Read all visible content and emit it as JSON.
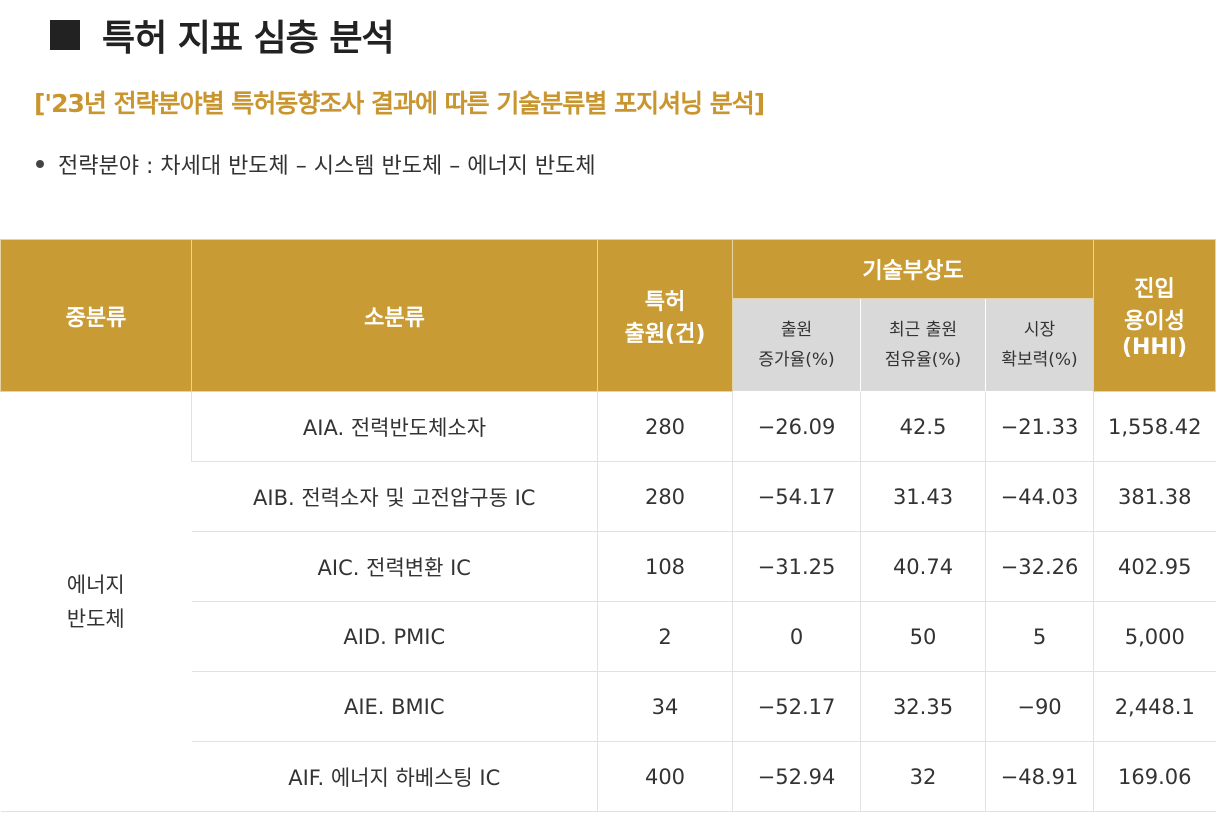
{
  "page": {
    "title": "특허 지표 심층 분석",
    "subtitle": "['23년 전략분야별 특허동향조사 결과에 따른 기술분류별 포지셔닝 분석]",
    "bullet": "전략분야 : 차세대 반도체 – 시스템 반도체 – 에너지 반도체"
  },
  "table": {
    "headers": {
      "mid_category": "중분류",
      "sub_category": "소분류",
      "patent_line1": "특허",
      "patent_line2": "출원(건)",
      "tech_group": "기술부상도",
      "growth_line1": "출원",
      "growth_line2": "증가율(%)",
      "share_line1": "최근 출원",
      "share_line2": "점유율(%)",
      "market_line1": "시장",
      "market_line2": "확보력(%)",
      "entry_line1": "진입",
      "entry_line2": "용이성",
      "entry_line3": "(HHI)"
    },
    "category_line1": "에너지",
    "category_line2": "반도체",
    "rows": [
      {
        "sub": "AIA. 전력반도체소자",
        "patents": "280",
        "growth": "−26.09",
        "share": "42.5",
        "market": "−21.33",
        "hhi": "1,558.42"
      },
      {
        "sub": "AIB. 전력소자 및 고전압구동 IC",
        "patents": "280",
        "growth": "−54.17",
        "share": "31.43",
        "market": "−44.03",
        "hhi": "381.38"
      },
      {
        "sub": "AIC. 전력변환 IC",
        "patents": "108",
        "growth": "−31.25",
        "share": "40.74",
        "market": "−32.26",
        "hhi": "402.95"
      },
      {
        "sub": "AID. PMIC",
        "patents": "2",
        "growth": "0",
        "share": "50",
        "market": "5",
        "hhi": "5,000"
      },
      {
        "sub": "AIE. BMIC",
        "patents": "34",
        "growth": "−52.17",
        "share": "32.35",
        "market": "−90",
        "hhi": "2,448.1"
      },
      {
        "sub": "AIF. 에너지 하베스팅 IC",
        "patents": "400",
        "growth": "−52.94",
        "share": "32",
        "market": "−48.91",
        "hhi": "169.06"
      }
    ]
  }
}
